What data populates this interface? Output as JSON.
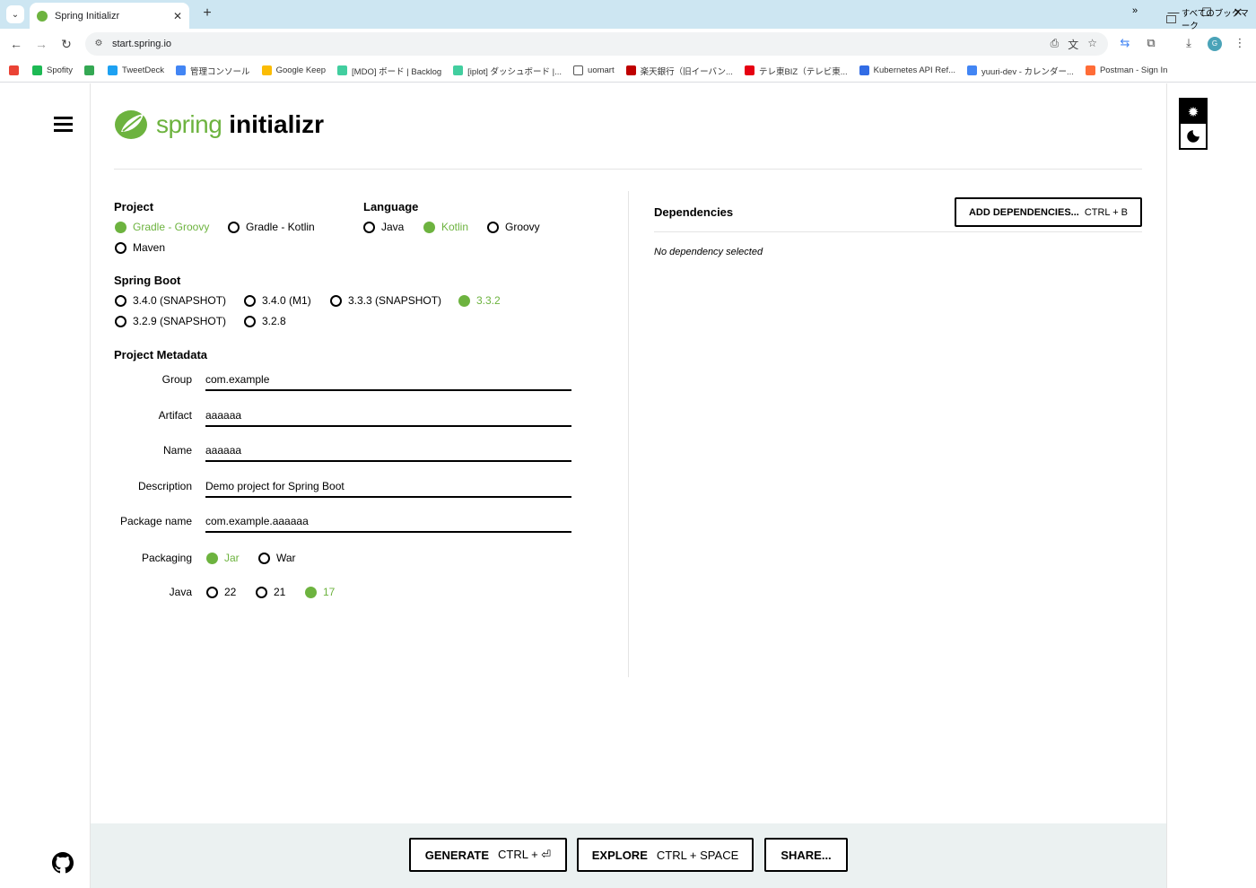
{
  "browser": {
    "tab_title": "Spring Initializr",
    "url": "start.spring.io",
    "bookmarks": [
      {
        "label": "",
        "color": "#ea4335"
      },
      {
        "label": "Spofity",
        "color": "#1db954"
      },
      {
        "label": "",
        "color": "#34a853"
      },
      {
        "label": "TweetDeck",
        "color": "#1da1f2"
      },
      {
        "label": "管理コンソール",
        "color": "#4285f4"
      },
      {
        "label": "Google Keep",
        "color": "#fbbc04"
      },
      {
        "label": "[MDO] ボード | Backlog",
        "color": "#42ce9f"
      },
      {
        "label": "[iplot] ダッシュボード |...",
        "color": "#42ce9f"
      },
      {
        "label": "uomart",
        "color": "#ffffff"
      },
      {
        "label": "楽天銀行（旧イーバン...",
        "color": "#bf0000"
      },
      {
        "label": "テレ東BIZ（テレビ東...",
        "color": "#e60012"
      },
      {
        "label": "Kubernetes API Ref...",
        "color": "#326ce5"
      },
      {
        "label": "yuuri-dev - カレンダー...",
        "color": "#4285f4"
      },
      {
        "label": "Postman - Sign In",
        "color": "#ff6c37"
      }
    ],
    "all_bookmarks": "すべてのブックマーク",
    "avatar_letter": "G"
  },
  "brand": {
    "spring": "spring",
    "initializr": "initializr",
    "accent": "#6db33f"
  },
  "project": {
    "title": "Project",
    "options": [
      "Gradle - Groovy",
      "Gradle - Kotlin",
      "Maven"
    ],
    "selected": "Gradle - Groovy"
  },
  "language": {
    "title": "Language",
    "options": [
      "Java",
      "Kotlin",
      "Groovy"
    ],
    "selected": "Kotlin"
  },
  "spring_boot": {
    "title": "Spring Boot",
    "options": [
      "3.4.0 (SNAPSHOT)",
      "3.4.0 (M1)",
      "3.3.3 (SNAPSHOT)",
      "3.3.2",
      "3.2.9 (SNAPSHOT)",
      "3.2.8"
    ],
    "selected": "3.3.2"
  },
  "metadata": {
    "title": "Project Metadata",
    "fields": [
      {
        "label": "Group",
        "value": "com.example"
      },
      {
        "label": "Artifact",
        "value": "aaaaaa"
      },
      {
        "label": "Name",
        "value": "aaaaaa"
      },
      {
        "label": "Description",
        "value": "Demo project for Spring Boot"
      },
      {
        "label": "Package name",
        "value": "com.example.aaaaaa"
      }
    ],
    "packaging": {
      "label": "Packaging",
      "options": [
        "Jar",
        "War"
      ],
      "selected": "Jar"
    },
    "java": {
      "label": "Java",
      "options": [
        "22",
        "21",
        "17"
      ],
      "selected": "17"
    }
  },
  "dependencies": {
    "title": "Dependencies",
    "add_label": "ADD DEPENDENCIES...",
    "add_shortcut": "CTRL + B",
    "empty": "No dependency selected"
  },
  "footer": {
    "generate": "GENERATE",
    "generate_shortcut": "CTRL + ⏎",
    "explore": "EXPLORE",
    "explore_shortcut": "CTRL + SPACE",
    "share": "SHARE..."
  }
}
